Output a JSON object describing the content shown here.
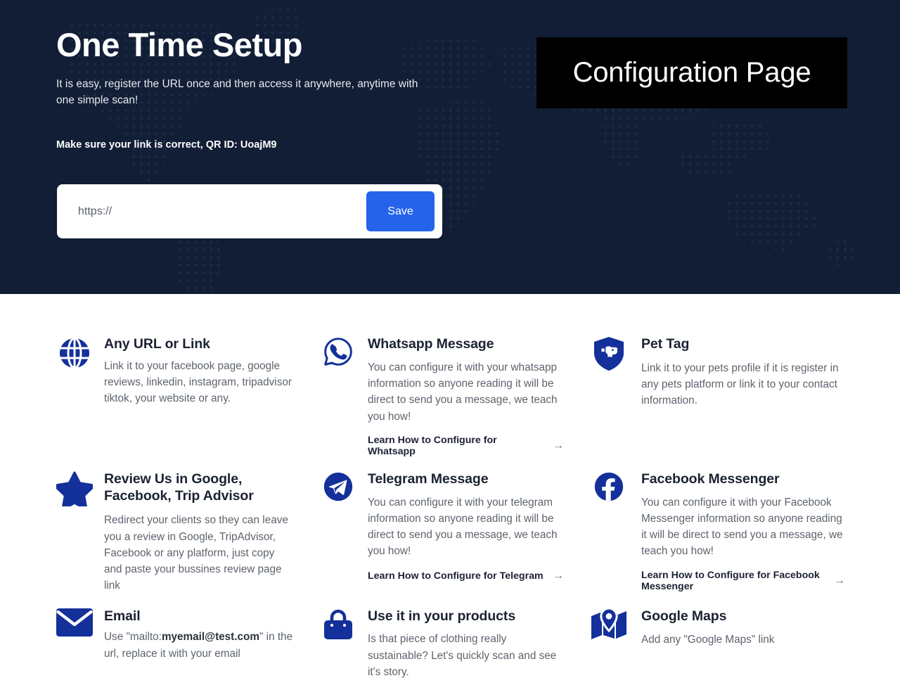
{
  "hero": {
    "title": "One Time Setup",
    "subtitle": "It is easy, register the URL once and then access it anywhere, anytime with one simple scan!",
    "note": "Make sure your link is correct, QR ID: UoajM9",
    "badge_label": "Configuration Page",
    "background_color": "#111e35",
    "badge_background": "#000000"
  },
  "url_form": {
    "placeholder": "https://",
    "value": "",
    "save_label": "Save",
    "save_color": "#2563eb"
  },
  "features": {
    "icon_color": "#14309a",
    "arrow_glyph": "→",
    "items": [
      {
        "icon": "globe-icon",
        "title": "Any URL or Link",
        "desc": "Link it to your facebook page, google reviews, linkedin, instagram, tripadvisor tiktok, your website or any.",
        "link": null
      },
      {
        "icon": "whatsapp-icon",
        "title": "Whatsapp Message",
        "desc": "You can configure it with your whatsapp information so anyone reading it will be direct to send you a message, we teach you how!",
        "link": "Learn How to Configure for Whatsapp"
      },
      {
        "icon": "pet-shield-icon",
        "title": "Pet Tag",
        "desc": "Link it to your pets profile if it is register in any pets platform or link it to your contact information.",
        "link": null
      },
      {
        "icon": "star-icon",
        "title": "Review Us in Google, Facebook, Trip Advisor",
        "desc": "Redirect your clients so they can leave you a review in Google, TripAdvisor, Facebook or any platform, just copy and paste your bussines review page link",
        "link": null
      },
      {
        "icon": "telegram-icon",
        "title": "Telegram Message",
        "desc": "You can configure it with your telegram information so anyone reading it will be direct to send you a message, we teach you how!",
        "link": "Learn How to Configure for Telegram"
      },
      {
        "icon": "facebook-icon",
        "title": "Facebook Messenger",
        "desc": "You can configure it with your Facebook Messenger information so anyone reading it will be direct to send you a message, we teach you how!",
        "link": "Learn How to Configure for Facebook Messenger"
      },
      {
        "icon": "envelope-icon",
        "title": "Email",
        "desc_prefix": "Use \"mailto:",
        "desc_bold": "myemail@test.com",
        "desc_suffix": "\" in the url, replace it with your email",
        "link": null
      },
      {
        "icon": "shopping-bag-icon",
        "title": "Use it in your products",
        "desc": "Is that piece of clothing really sustainable? Let's quickly scan and see it's story.",
        "link": null
      },
      {
        "icon": "google-maps-icon",
        "title": "Google Maps",
        "desc": "Add any \"Google Maps\" link",
        "link": null
      }
    ]
  }
}
